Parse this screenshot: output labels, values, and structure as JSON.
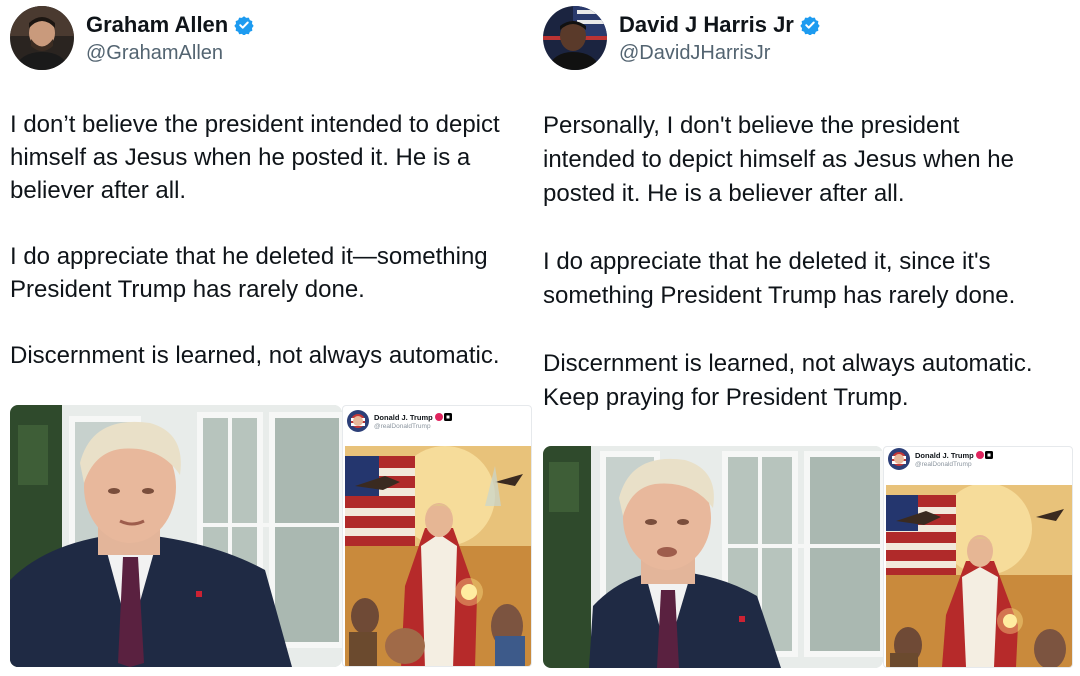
{
  "tweets": [
    {
      "author": {
        "name": "Graham Allen",
        "handle": "@GrahamAllen",
        "verified": true
      },
      "paragraphs": [
        "I don’t believe the president intended to depict himself as Jesus when he posted it. He is a believer after all.",
        "I do appreciate that he deleted it—something President Trump has rarely done.",
        "Discernment is learned, not always automatic."
      ],
      "embedded_post": {
        "name": "Donald J. Trump",
        "handle": "@realDonaldTrump"
      }
    },
    {
      "author": {
        "name": "David J Harris Jr",
        "handle": "@DavidJHarrisJr",
        "verified": true
      },
      "paragraphs": [
        "Personally, I don't believe the president intended to depict himself as Jesus when he posted it. He is a believer after all.",
        "I do appreciate that he deleted it, since it's something President Trump has rarely done.",
        "Discernment is learned, not always automatic. Keep praying for President Trump."
      ],
      "embedded_post": {
        "name": "Donald J. Trump",
        "handle": "@realDonaldTrump"
      }
    }
  ],
  "colors": {
    "verified": "#1d9bf0",
    "handle": "#536471",
    "text": "#0f1419"
  }
}
